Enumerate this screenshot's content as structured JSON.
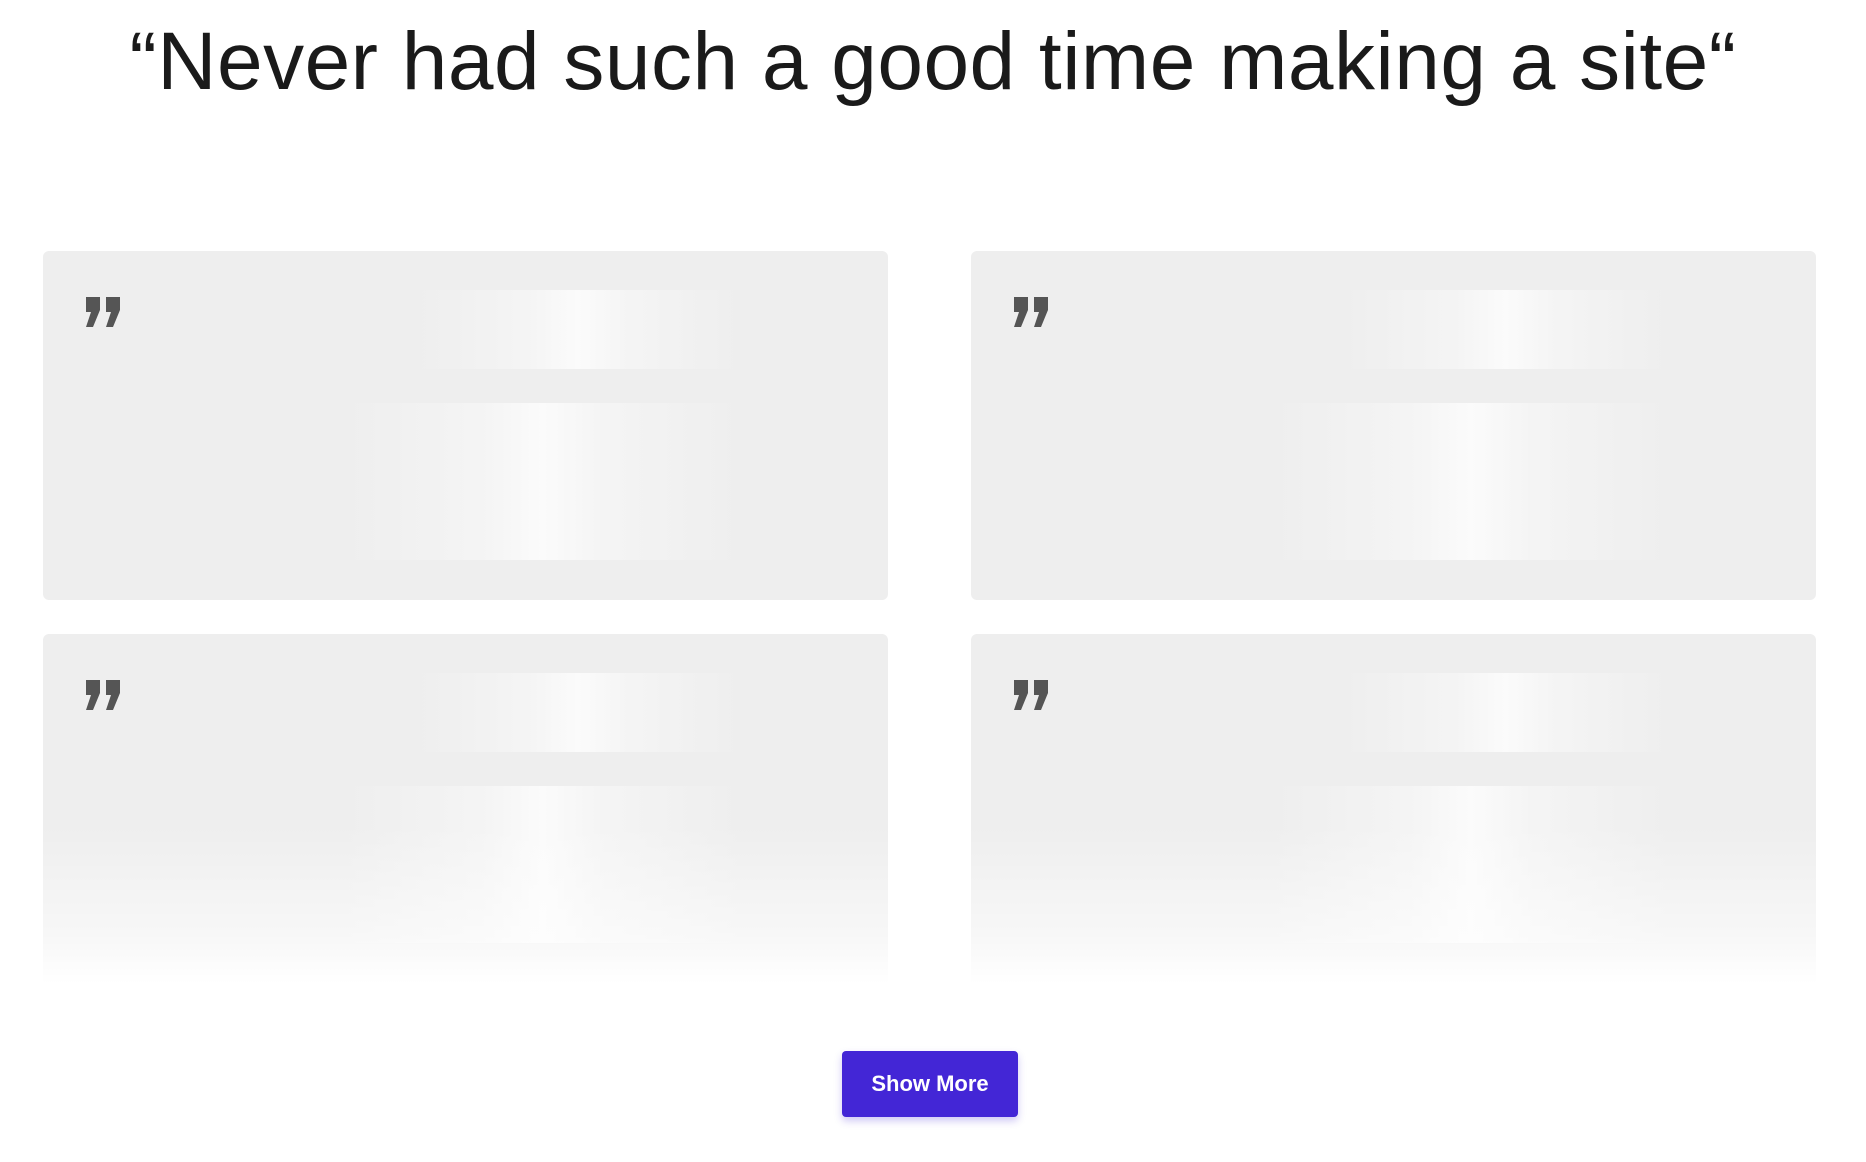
{
  "header": {
    "title": "“Never had such a good time making a site“"
  },
  "testimonials": {
    "cards": [
      {
        "icon": "quote-icon"
      },
      {
        "icon": "quote-icon"
      },
      {
        "icon": "quote-icon"
      },
      {
        "icon": "quote-icon"
      }
    ]
  },
  "actions": {
    "show_more_label": "Show More"
  },
  "colors": {
    "accent": "#4326d6",
    "card_background": "#eeeeee",
    "icon": "#555555",
    "title_text": "#1a1a1a"
  }
}
